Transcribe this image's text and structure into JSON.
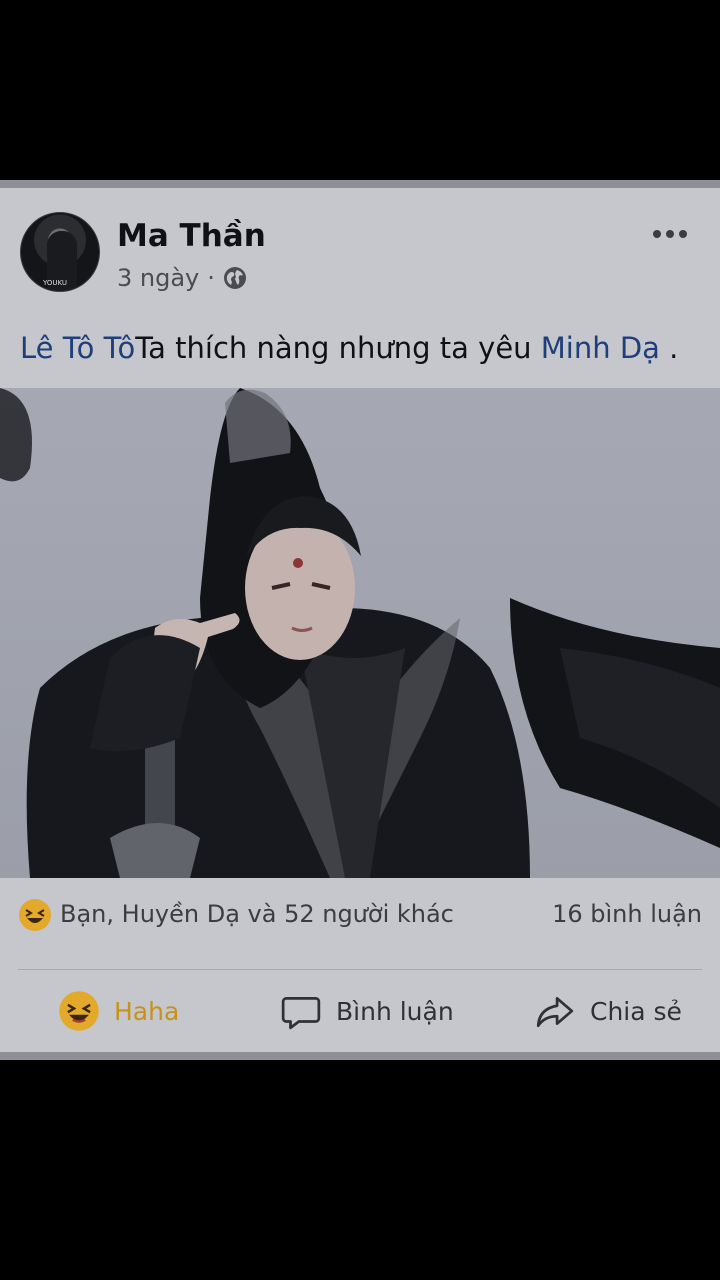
{
  "post": {
    "author": "Ma Thần",
    "time": "3 ngày",
    "separator": "·",
    "privacy_icon": "globe-icon",
    "more_icon": "more-icon",
    "avatar_watermark": "YOUKU",
    "caption": {
      "mention_1": "Lê Tô Tô",
      "text": "Ta thích nàng nhưng ta yêu ",
      "mention_2": "Minh Dạ",
      "end": " ."
    }
  },
  "reactions": {
    "icon": "haha-emoji-icon",
    "summary": "Bạn, Huyền Dạ và 52 người khác",
    "comments": "16 bình luận"
  },
  "actions": {
    "haha_label": "Haha",
    "comment_label": "Bình luận",
    "share_label": "Chia sẻ"
  },
  "colors": {
    "card_bg": "#c5c7cc",
    "mention": "#1e3f7a",
    "haha": "#c79219",
    "background": "#000000"
  }
}
